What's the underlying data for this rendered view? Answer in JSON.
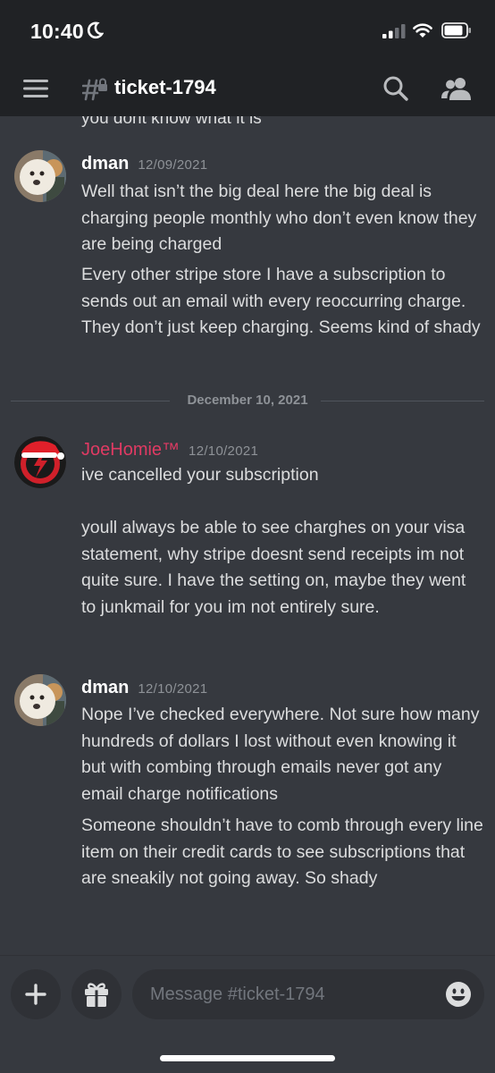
{
  "status_bar": {
    "time": "10:40"
  },
  "header": {
    "channel_name": "ticket-1794"
  },
  "clipped_message": "you dont know what it is",
  "messages": [
    {
      "author": "dman",
      "timestamp": "12/09/2021",
      "paragraphs": [
        "Well that isn’t the big deal here the big deal is charging people monthly who don’t even know they are being charged",
        "Every other stripe store I have a subscription to sends out an email with every reoccurring charge. They don’t just keep charging. Seems kind of shady"
      ]
    },
    {
      "author": "JoeHomie™",
      "timestamp": "12/10/2021",
      "paragraphs": [
        "ive cancelled your subscription",
        "youll always be able to see charghes on your visa statement, why stripe doesnt send receipts im not quite sure. I have the setting on, maybe they went to junkmail for you im not entirely sure."
      ]
    },
    {
      "author": "dman",
      "timestamp": "12/10/2021",
      "paragraphs": [
        "Nope I’ve checked everywhere. Not sure how many hundreds of dollars I lost without even knowing it but with combing through emails never got any email charge notifications",
        "Someone shouldn’t have to comb through every line item on their credit cards to see subscriptions that are sneakily not going away. So shady"
      ]
    }
  ],
  "date_divider": "December 10, 2021",
  "composer": {
    "placeholder": "Message #ticket-1794"
  },
  "colors": {
    "background": "#36393f",
    "header": "#202225",
    "joe_name": "#e03a63",
    "timestamp": "#8e9297"
  },
  "icons": [
    "moon-icon",
    "signal-icon",
    "wifi-icon",
    "battery-icon",
    "hamburger-icon",
    "locked-channel-icon",
    "search-icon",
    "members-icon",
    "plus-icon",
    "gift-icon",
    "emoji-icon"
  ]
}
